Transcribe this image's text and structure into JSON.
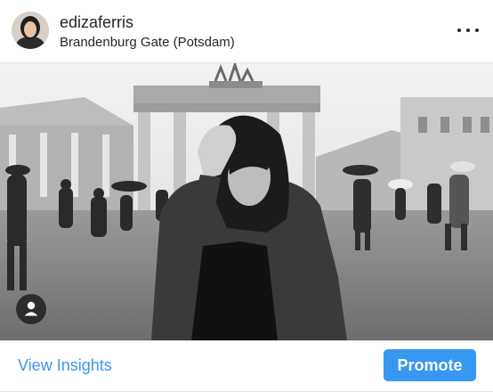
{
  "post": {
    "username": "edizaferris",
    "location": "Brandenburg Gate (Potsdam)"
  },
  "actions": {
    "insights_label": "View Insights",
    "promote_label": "Promote"
  },
  "icons": {
    "more": "more-options-icon",
    "tag": "person-tag-icon"
  },
  "colors": {
    "accent": "#3897f0",
    "text": "#262626"
  }
}
